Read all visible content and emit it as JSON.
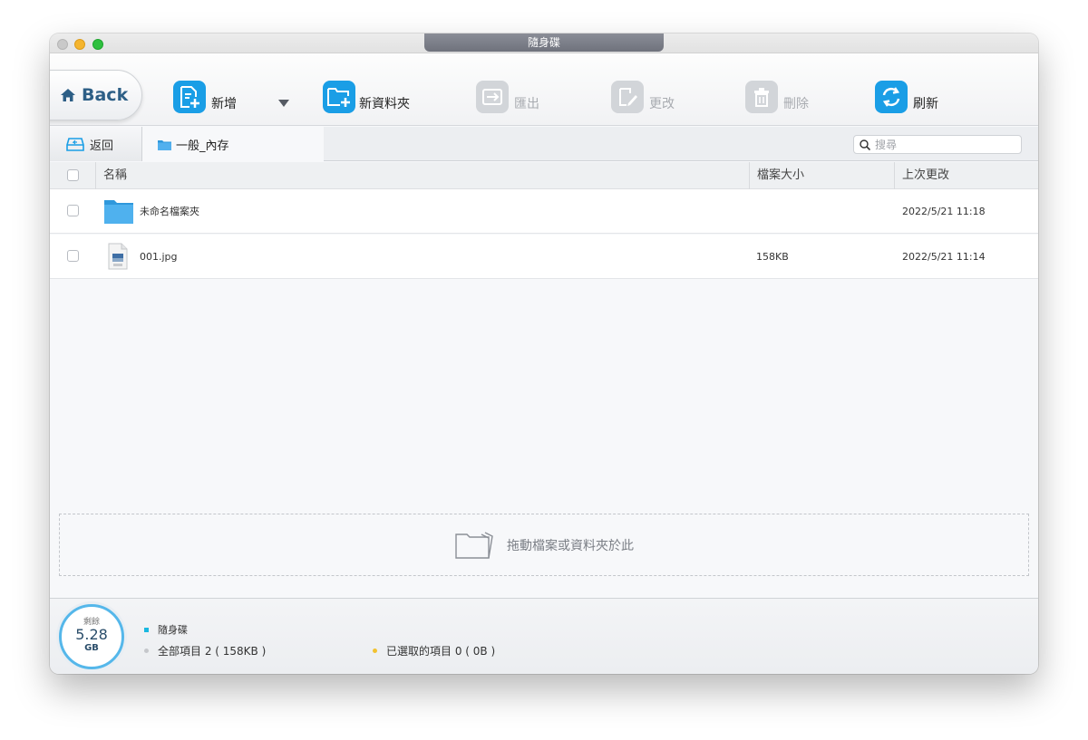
{
  "window": {
    "title": "隨身碟"
  },
  "toolbar": {
    "back_label": "Back",
    "new_label": "新增",
    "new_folder_label": "新資料夾",
    "export_label": "匯出",
    "rename_label": "更改",
    "delete_label": "刪除",
    "refresh_label": "刷新"
  },
  "pathbar": {
    "back_label": "返回",
    "current_folder": "一般_內存",
    "search_placeholder": "搜尋"
  },
  "list": {
    "columns": {
      "name": "名稱",
      "size": "檔案大小",
      "modified": "上次更改"
    },
    "rows": [
      {
        "name": "未命名檔案夾",
        "size": "",
        "modified": "2022/5/21  11:18",
        "type": "folder"
      },
      {
        "name": "001.jpg",
        "size": "158KB",
        "modified": "2022/5/21  11:14",
        "type": "jpeg"
      }
    ]
  },
  "dropzone": {
    "label": "拖動檔案或資料夾於此"
  },
  "footer": {
    "gauge_label": "剩餘",
    "gauge_value": "5.28",
    "gauge_unit": "GB",
    "device_name": "隨身碟",
    "total_items": "全部項目 2 ( 158KB )",
    "selected_items": "已選取的項目 0 ( 0B )"
  },
  "colors": {
    "accent": "#1a9ee6",
    "disabled": "#d2d5d9",
    "selected_dot": "#f2c230",
    "device_square": "#1ab8e0"
  }
}
